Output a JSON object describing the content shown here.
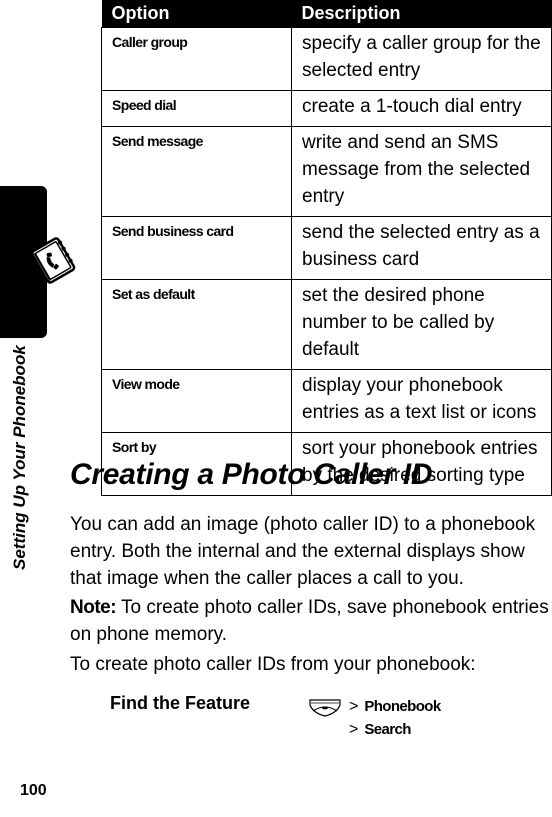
{
  "side_tab": {
    "title": "Setting Up Your Phonebook",
    "icon": "phonebook-icon"
  },
  "table": {
    "headers": [
      "Option",
      "Description"
    ],
    "rows": [
      {
        "option": "Caller group",
        "description": "specify a caller group for the selected entry"
      },
      {
        "option": "Speed dial",
        "description": "create a 1-touch dial entry"
      },
      {
        "option": "Send message",
        "description": "write and send an SMS message from the selected entry"
      },
      {
        "option": "Send business card",
        "description": "send the selected entry as a business card"
      },
      {
        "option": "Set as default",
        "description": "set the desired phone number to be called by default"
      },
      {
        "option": "View mode",
        "description": "display your phonebook entries as a text list or icons"
      },
      {
        "option": "Sort by",
        "description": "sort your phonebook entries by the desired sorting type"
      }
    ]
  },
  "section": {
    "title": "Creating a Photo Caller ID",
    "paragraph1": "You can add an image (photo caller ID) to a phonebook entry. Both the internal and the external displays show that image when the caller places a call to you.",
    "note_label": "Note:",
    "note_text": " To create photo caller IDs, save phonebook entries on phone memory.",
    "paragraph3": "To create photo caller IDs from your phonebook:"
  },
  "find_feature": {
    "label": "Find the Feature",
    "key_icon": "menu-key-icon",
    "separator": ">",
    "steps": [
      "Phonebook",
      "Search"
    ]
  },
  "page_number": "100"
}
